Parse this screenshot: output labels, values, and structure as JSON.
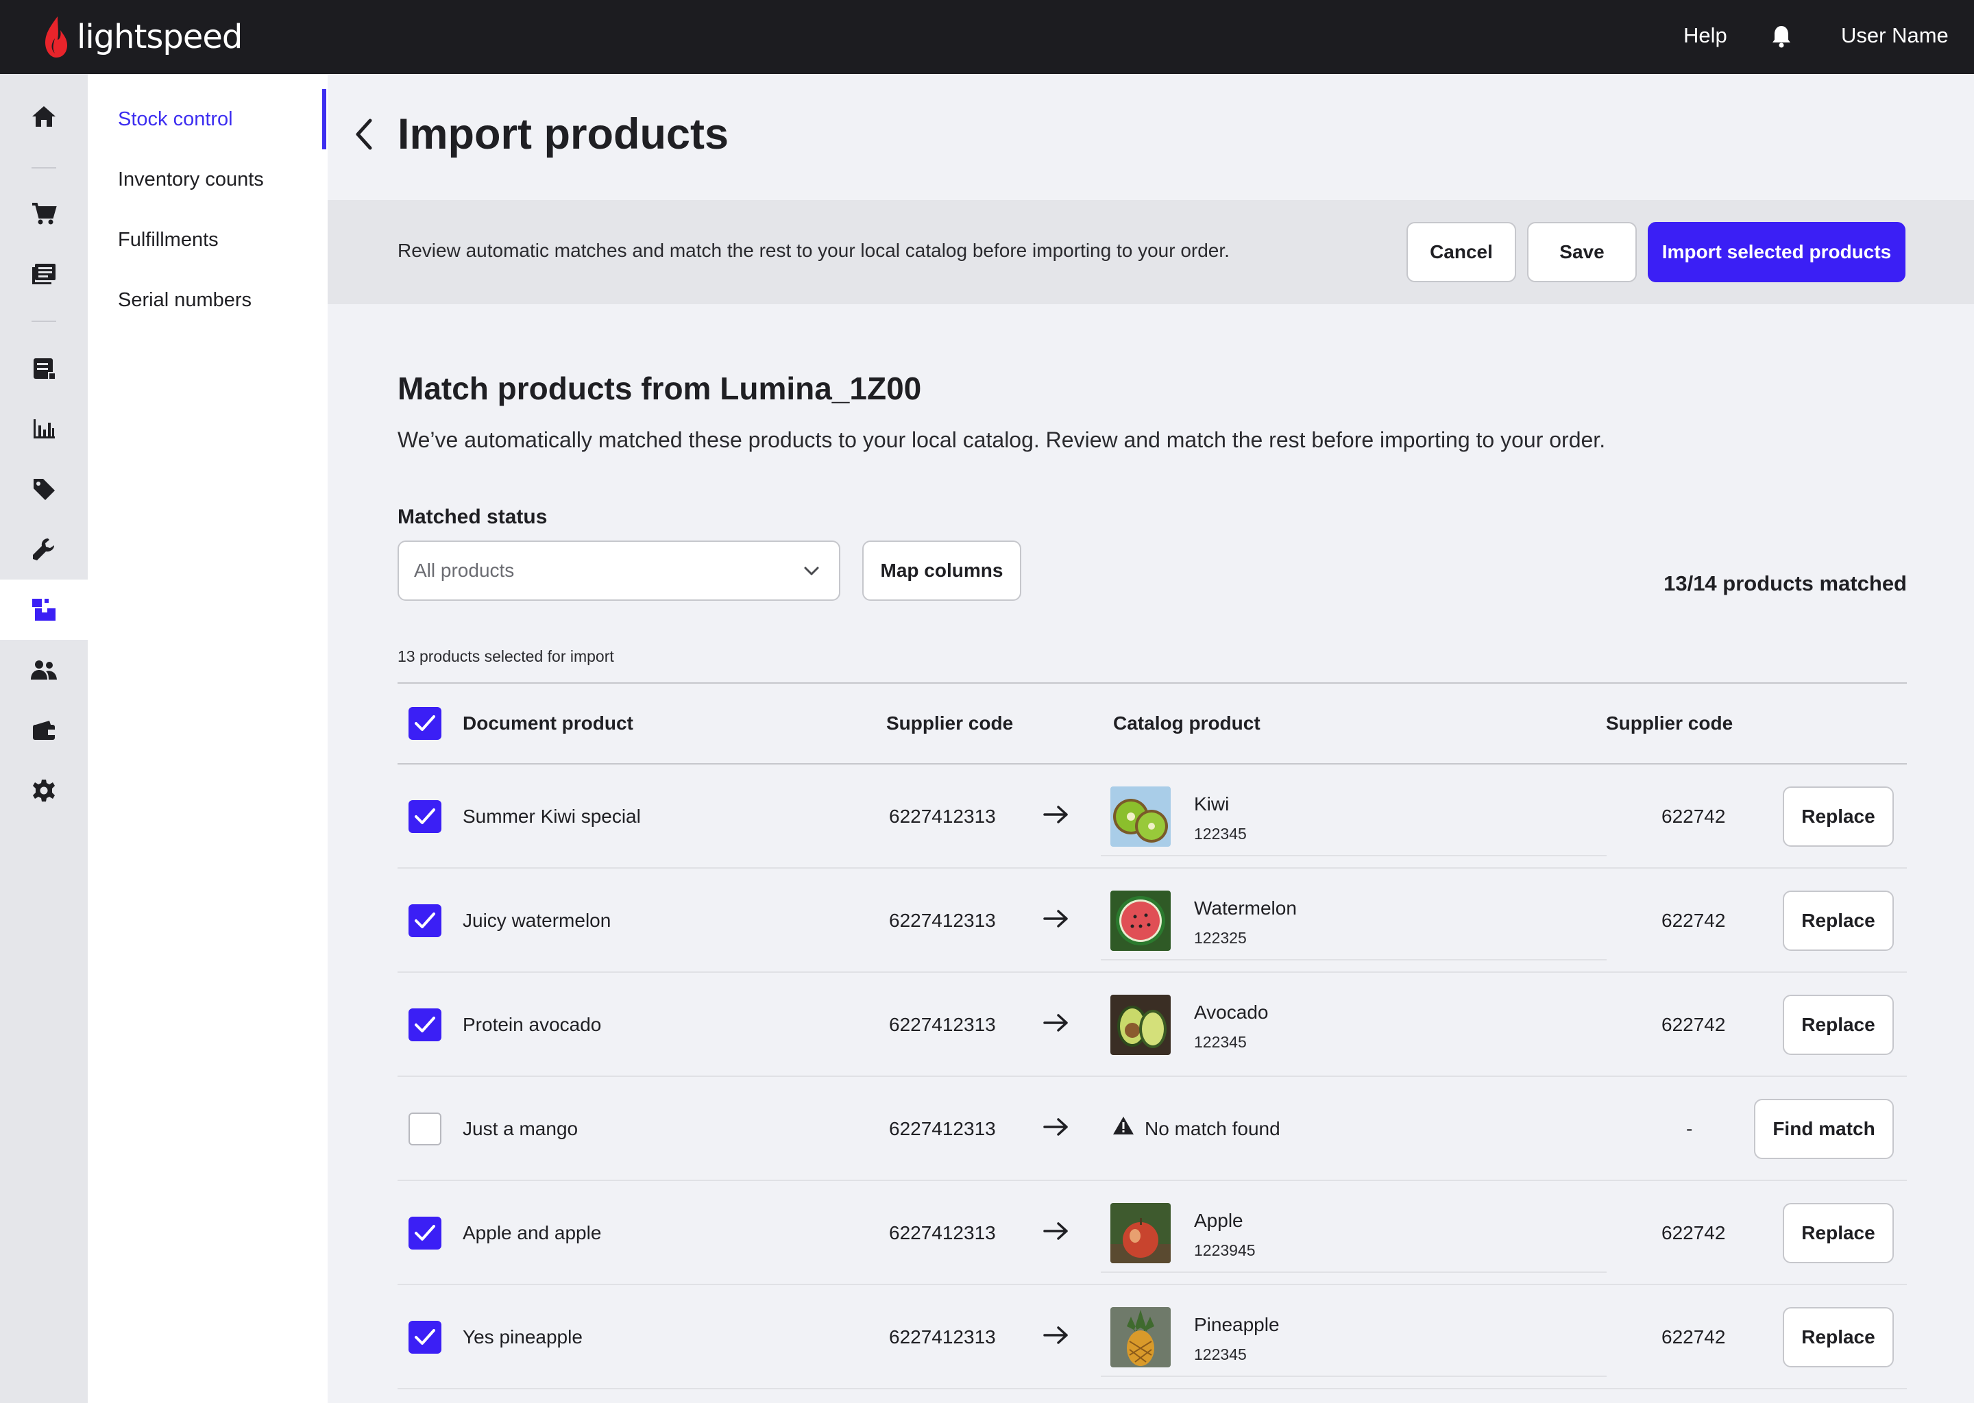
{
  "brand": {
    "name": "lightspeed",
    "accent": "#3b1ff5",
    "logo_color": "#e8242b"
  },
  "topbar": {
    "help": "Help",
    "user": "User Name"
  },
  "rail": {
    "items": [
      "home-icon",
      "cart-icon",
      "catalog-icon",
      "invoice-icon",
      "chart-icon",
      "tag-icon",
      "wrench-icon",
      "inventory-icon",
      "customers-icon",
      "wallet-icon",
      "settings-icon"
    ],
    "active": "inventory-icon"
  },
  "subnav": {
    "items": [
      "Stock control",
      "Inventory counts",
      "Fulfillments",
      "Serial numbers"
    ],
    "active": "Stock control"
  },
  "header": {
    "title": "Import products"
  },
  "actionbar": {
    "text": "Review automatic matches and match the rest to your local catalog before importing to your order.",
    "cancel": "Cancel",
    "save": "Save",
    "import": "Import selected products"
  },
  "section": {
    "title": "Match products from Lumina_1Z00",
    "description": "We’ve automatically matched these products to your local catalog. Review and match the rest before importing to your order."
  },
  "filter": {
    "label": "Matched status",
    "value": "All products",
    "map_columns": "Map columns",
    "matched_count": "13/14 products matched",
    "selected_count": "13 products selected for import"
  },
  "table": {
    "headers": {
      "document_product": "Document product",
      "supplier_code": "Supplier code",
      "catalog_product": "Catalog product",
      "catalog_supplier_code": "Supplier code"
    },
    "header_checked": true,
    "rows": [
      {
        "checked": true,
        "document": "Summer Kiwi special",
        "supplier_code": "6227412313",
        "catalog_name": "Kiwi",
        "catalog_code": "122345",
        "catalog_supplier": "622742",
        "action": "Replace",
        "thumb": "kiwi"
      },
      {
        "checked": true,
        "document": "Juicy watermelon",
        "supplier_code": "6227412313",
        "catalog_name": "Watermelon",
        "catalog_code": "122325",
        "catalog_supplier": "622742",
        "action": "Replace",
        "thumb": "watermelon"
      },
      {
        "checked": true,
        "document": "Protein avocado",
        "supplier_code": "6227412313",
        "catalog_name": "Avocado",
        "catalog_code": "122345",
        "catalog_supplier": "622742",
        "action": "Replace",
        "thumb": "avocado"
      },
      {
        "checked": false,
        "document": "Just a mango",
        "supplier_code": "6227412313",
        "no_match": "No match found",
        "catalog_supplier": "-",
        "action": "Find match"
      },
      {
        "checked": true,
        "document": "Apple and apple",
        "supplier_code": "6227412313",
        "catalog_name": "Apple",
        "catalog_code": "1223945",
        "catalog_supplier": "622742",
        "action": "Replace",
        "thumb": "apple"
      },
      {
        "checked": true,
        "document": "Yes pineapple",
        "supplier_code": "6227412313",
        "catalog_name": "Pineapple",
        "catalog_code": "122345",
        "catalog_supplier": "622742",
        "action": "Replace",
        "thumb": "pineapple"
      }
    ]
  }
}
